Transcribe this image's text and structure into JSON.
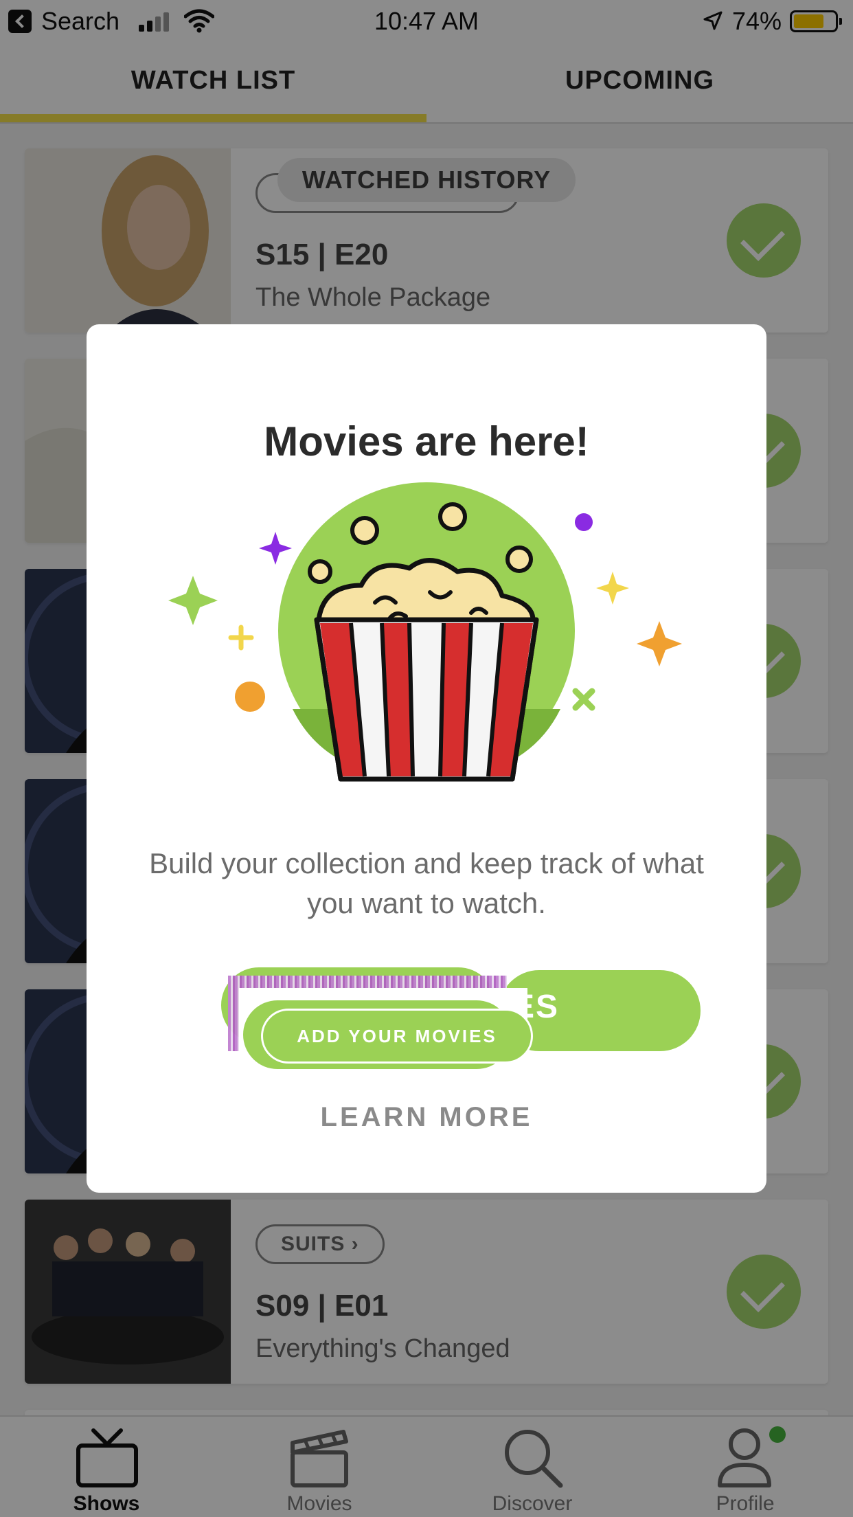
{
  "status_bar": {
    "back_label": "Search",
    "time": "10:47 AM",
    "battery_percent_label": "74%",
    "battery_level": 0.74
  },
  "tabs": [
    {
      "label": "WATCH LIST",
      "active": true
    },
    {
      "label": "UPCOMING",
      "active": false
    }
  ],
  "watched_history_label": "WATCHED HISTORY",
  "cards": [
    {
      "show": "",
      "episode": "S15 | E20",
      "title": "The Whole Package",
      "watched": true
    },
    {
      "show": "",
      "episode": "",
      "title": "",
      "watched": true
    },
    {
      "show": "",
      "episode": "",
      "title": "",
      "watched": true
    },
    {
      "show": "",
      "episode": "",
      "title": "",
      "watched": true
    },
    {
      "show": "",
      "episode": "",
      "title": "",
      "watched": true
    },
    {
      "show": "SUITS ›",
      "episode": "S09 | E01",
      "title": "Everything's Changed",
      "watched": true
    }
  ],
  "modal": {
    "title": "Movies are here!",
    "description": "Build your collection and keep track of what you want to watch.",
    "primary_button": "ADD YOUR MOVIES",
    "primary_button_echo": "ES",
    "secondary_link": "LEARN MORE"
  },
  "bottom_nav": [
    {
      "label": "Shows",
      "icon": "tv-icon",
      "active": true
    },
    {
      "label": "Movies",
      "icon": "clapperboard-icon",
      "active": false
    },
    {
      "label": "Discover",
      "icon": "search-icon",
      "active": false
    },
    {
      "label": "Profile",
      "icon": "person-icon",
      "active": false,
      "badge": true
    }
  ],
  "colors": {
    "accent_green": "#9bd155",
    "tab_underline": "#f4e14a",
    "check_green": "#a5d76e",
    "badge_green": "#46b43c"
  }
}
